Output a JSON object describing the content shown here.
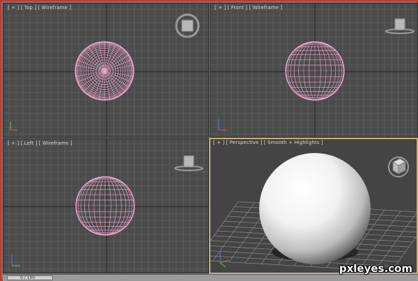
{
  "viewports": {
    "top": {
      "label": "[ + ] [ Top ] [ Wireframe ]"
    },
    "front": {
      "label": "[ + ] [ Front ] [ Wireframe ]"
    },
    "left": {
      "label": "[ + ] [ Left ] [ Wireframe ]"
    },
    "perspective": {
      "label": "[ + ] [ Perspective ] [ Smooth + Highlights ]"
    }
  },
  "timeline": {
    "frame": "0 / 100"
  },
  "watermark": "pxleyes.com",
  "colors": {
    "wireframe": "#f0a8d0",
    "grid": "#6a6a6a",
    "grid_major": "#2a2a2a",
    "active_border": "#c7b27a",
    "app_border": "#c0392b"
  }
}
